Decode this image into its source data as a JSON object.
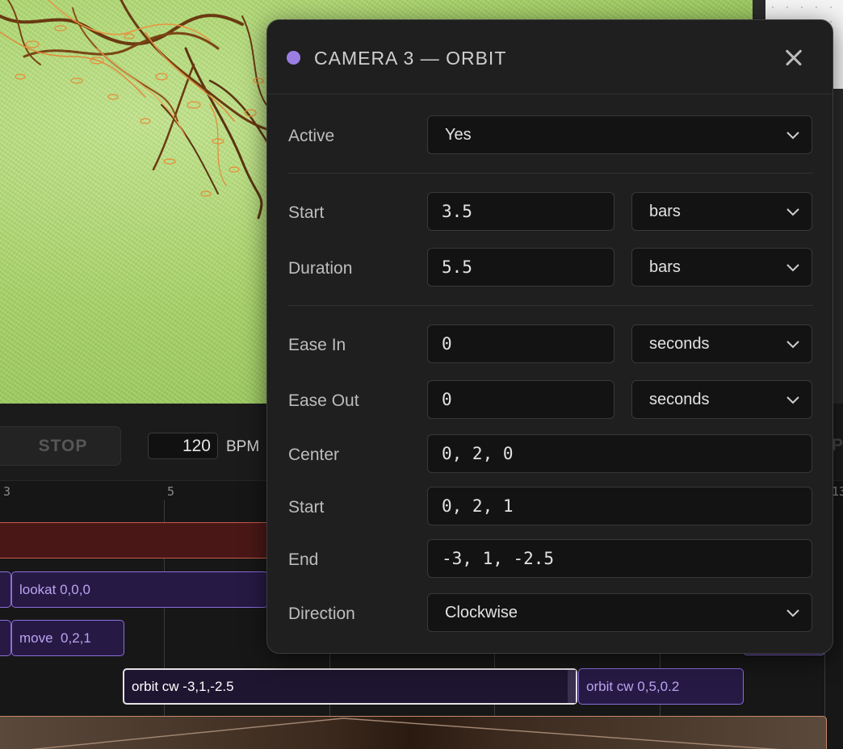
{
  "transport": {
    "stop_label": "STOP",
    "bpm_value": "120",
    "bpm_label": "BPM",
    "right_clipped_label": "PS"
  },
  "timeline": {
    "ticks": [
      "3",
      "5",
      "13"
    ],
    "clips": {
      "lookat": "lookat 0,0,0",
      "move": "move  0,2,1",
      "orbit_selected": "orbit cw -3,1,-2.5",
      "orbit_next": "orbit cw 0,5,0.2"
    }
  },
  "dialog": {
    "title": "CAMERA 3 — ORBIT",
    "accent_color": "#9b7ee3",
    "fields": {
      "active": {
        "label": "Active",
        "value": "Yes"
      },
      "start": {
        "label": "Start",
        "value": "3.5",
        "unit": "bars"
      },
      "duration": {
        "label": "Duration",
        "value": "5.5",
        "unit": "bars"
      },
      "ease_in": {
        "label": "Ease In",
        "value": "0",
        "unit": "seconds"
      },
      "ease_out": {
        "label": "Ease Out",
        "value": "0",
        "unit": "seconds"
      },
      "center": {
        "label": "Center",
        "value": "0, 2, 0"
      },
      "orbit_start": {
        "label": "Start",
        "value": "0, 2, 1"
      },
      "orbit_end": {
        "label": "End",
        "value": "-3, 1, -2.5"
      },
      "direction": {
        "label": "Direction",
        "value": "Clockwise"
      }
    },
    "icons": [
      "status-dot",
      "close-icon",
      "chevron-down-icon"
    ]
  }
}
